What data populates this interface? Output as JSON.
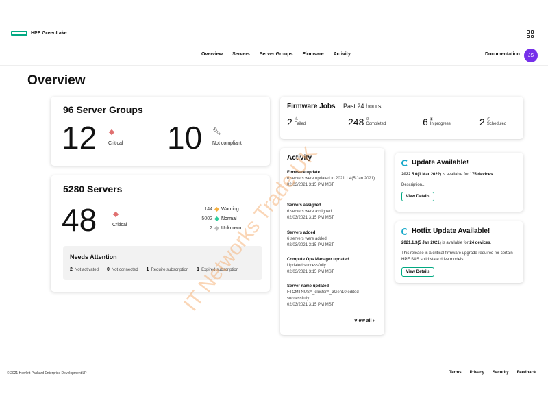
{
  "header": {
    "logo_text": "HPE GreenLake",
    "apps_icon": "apps-grid-icon"
  },
  "nav": {
    "links": [
      "Overview",
      "Servers",
      "Server Groups",
      "Firmware",
      "Activity"
    ],
    "documentation": "Documentation",
    "avatar_initials": "JS",
    "avatar_color": "#7630ea"
  },
  "page_title": "Overview",
  "server_groups": {
    "title": "96 Server Groups",
    "critical_count": "12",
    "critical_label": "Critical",
    "noncompliant_count": "10",
    "noncompliant_label": "Not compliant"
  },
  "servers": {
    "title": "5280 Servers",
    "critical_count": "48",
    "critical_label": "Critical",
    "statuses": [
      {
        "count": "144",
        "label": "Warning",
        "color": "#f5b041"
      },
      {
        "count": "5002",
        "label": "Normal",
        "color": "#2ecc9a"
      },
      {
        "count": "2",
        "label": "Unknown",
        "color": "#bbbbbb"
      }
    ],
    "needs_attention": {
      "title": "Needs Attention",
      "items": [
        {
          "count": "2",
          "label": "Not activated"
        },
        {
          "count": "0",
          "label": "Not connected"
        },
        {
          "count": "1",
          "label": "Require subscription"
        },
        {
          "count": "1",
          "label": "Expired subscription"
        }
      ]
    }
  },
  "firmware_jobs": {
    "title": "Firmware Jobs",
    "subtitle": "Past 24 hours",
    "stats": [
      {
        "count": "2",
        "label": "Failed"
      },
      {
        "count": "248",
        "label": "Completed"
      },
      {
        "count": "6",
        "label": "In progress"
      },
      {
        "count": "2",
        "label": "Scheduled"
      }
    ]
  },
  "activity": {
    "title": "Activity",
    "items": [
      {
        "title": "Firmware update",
        "desc": "6 servers were updated to 2021.1.4(5 Jan 2021)",
        "time": "02/03/2021 3:15 PM MST"
      },
      {
        "title": "Servers assigned",
        "desc": "6 servers were assigned",
        "time": "02/03/2021 3:15 PM MST"
      },
      {
        "title": "Servers added",
        "desc": "6 servers were added.",
        "time": "02/03/2021 3:15 PM MST"
      },
      {
        "title": "Compute Ops Manager updated",
        "desc": "Updated successfully.",
        "time": "02/03/2021 3:15 PM MST"
      },
      {
        "title": "Server name updated",
        "desc": "FTCMTNUSA_clusterA_3Gen10 edited successfully.",
        "time": "02/03/2021 3:15 PM MST"
      }
    ],
    "view_all": "View all"
  },
  "update_card": {
    "title": "Update Available!",
    "version": "2022.5.0(1 Mar 2022)",
    "text_mid": " is available for ",
    "devices": "175 devices",
    "text_end": ".",
    "description": "Description...",
    "button": "View Details"
  },
  "hotfix_card": {
    "title": "Hotfix Update Available!",
    "version": "2021.1.3(5 Jan 2021)",
    "text_mid": " is available for ",
    "devices": "24 devices",
    "text_end": ".",
    "description": "This release is a critical firmware upgrade required for certain HPE SAS solid state drive models.",
    "button": "View Details"
  },
  "watermark": "IT Networks Trade UK",
  "footer": {
    "copyright": "© 2021 Hewlett Packard Enterprise Development LP",
    "links": [
      "Terms",
      "Privacy",
      "Security",
      "Feedback"
    ]
  },
  "colors": {
    "accent": "#01a982",
    "critical": "#e07070",
    "refresh": "#17a8c9"
  }
}
